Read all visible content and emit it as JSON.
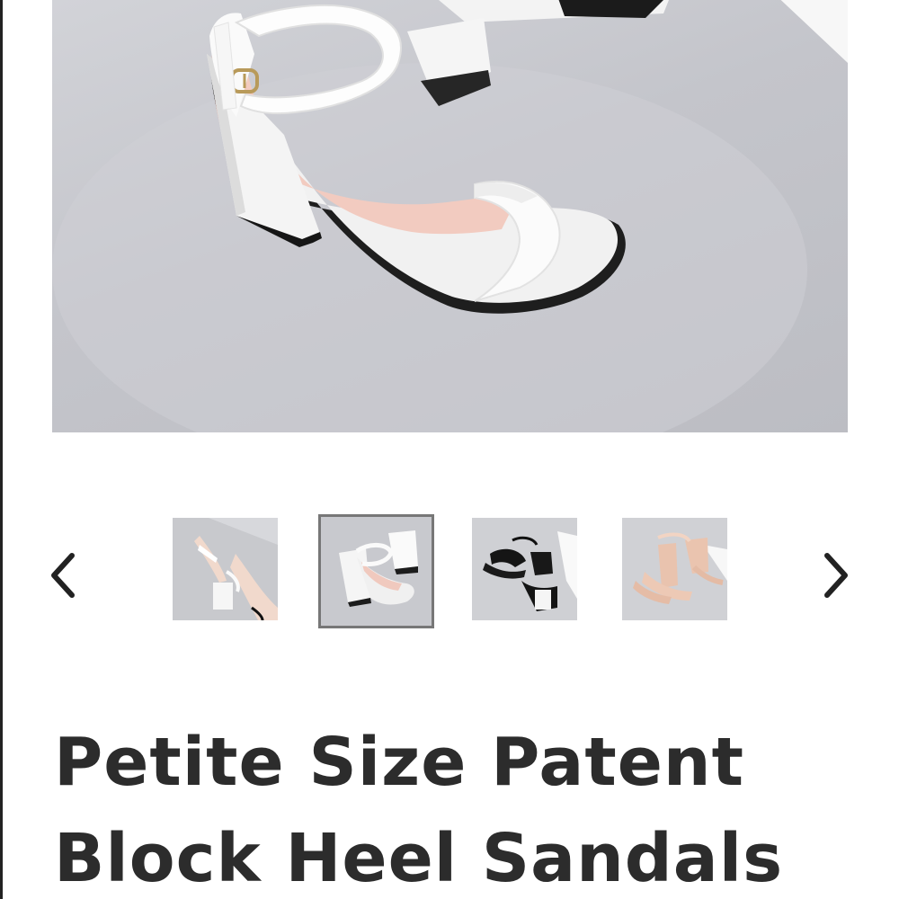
{
  "product": {
    "title": "Petite Size Patent Block Heel Sandals"
  },
  "main_image": {
    "subject": "white ankle-strap block heel sandal",
    "background_color": "#c6c7cc"
  },
  "gallery": {
    "prev_icon": "chevron-left-icon",
    "next_icon": "chevron-right-icon",
    "thumbnails": [
      {
        "color": "white",
        "selected": false
      },
      {
        "color": "white",
        "selected": true
      },
      {
        "color": "black",
        "selected": false
      },
      {
        "color": "nude",
        "selected": false
      }
    ],
    "selected_index": 1
  },
  "colors": {
    "title_text": "#2c2c2c",
    "selected_border": "#777777",
    "arrow": "#222222"
  }
}
